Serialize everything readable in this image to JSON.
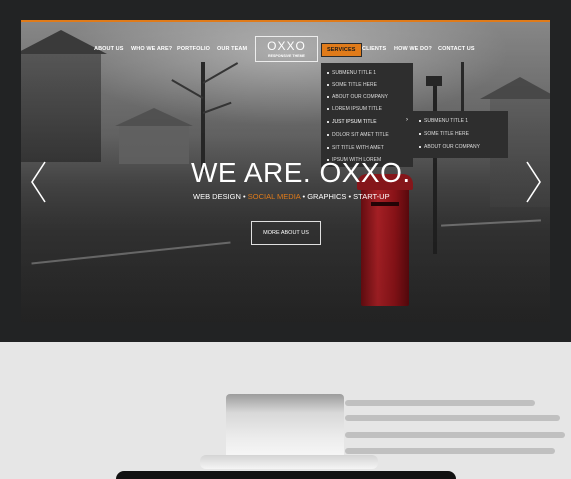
{
  "nav": {
    "left": [
      "ABOUT US",
      "WHO WE ARE?",
      "PORTFOLIO",
      "OUR TEAM"
    ],
    "right": [
      "SERVICES",
      "CLIENTS",
      "HOW WE DO?",
      "CONTACT US"
    ],
    "active": "SERVICES"
  },
  "logo": {
    "name": "OXXO",
    "tagline": "RESPONSIVE THEME"
  },
  "dropdown": {
    "items": [
      "SUBMENU TITLE 1",
      "SOME TITLE HERE",
      "ABOUT OUR COMPANY",
      "LOREM IPSUM TITLE",
      "JUST IPSUM TITLE",
      "DOLOR SIT AMET TITLE",
      "SIT TITLE WITH AMET",
      "IPSUM WITH LOREM"
    ],
    "highlighted": "JUST IPSUM TITLE",
    "arrow": "›"
  },
  "submenu": {
    "items": [
      "SUBMENU TITLE 1",
      "SOME TITLE HERE",
      "ABOUT OUR COMPANY"
    ]
  },
  "hero": {
    "title": "WE ARE. OXXO.",
    "sub": {
      "part1": "WEB DESIGN",
      "sep": " • ",
      "part2": "SOCIAL MEDIA",
      "part3": "GRAPHICS",
      "part4": "START-UP"
    },
    "button": "MORE ABOUT US"
  },
  "colors": {
    "accent": "#e07b1a",
    "bezel": "#222324"
  }
}
